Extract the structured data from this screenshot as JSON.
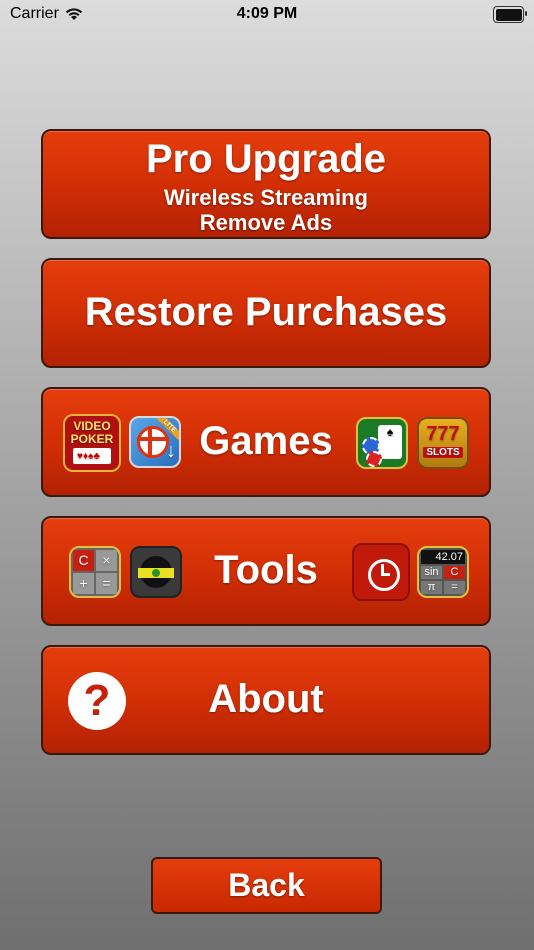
{
  "status_bar": {
    "carrier": "Carrier",
    "time": "4:09 PM",
    "icons": [
      "wifi-icon",
      "battery-icon"
    ]
  },
  "menu": {
    "pro_upgrade": {
      "title": "Pro Upgrade",
      "line1": "Wireless Streaming",
      "line2": "Remove Ads"
    },
    "restore_label": "Restore Purchases",
    "games": {
      "label": "Games",
      "icons": {
        "video_poker": {
          "line1": "VIDEO",
          "line2": "POKER"
        },
        "level_lite": {
          "badge": "LITE"
        },
        "solitaire": {},
        "slots": {
          "top": "777",
          "bottom": "SLOTS"
        }
      }
    },
    "tools": {
      "label": "Tools",
      "icons": {
        "calculator": {
          "keys": [
            "C",
            "×",
            "+",
            "="
          ]
        },
        "level": {},
        "alarm_clock": {},
        "sci_calculator": {
          "display": "42.07",
          "keys": [
            "sin",
            "C",
            "π",
            "="
          ]
        }
      }
    },
    "about_label": "About",
    "about_icon_glyph": "?"
  },
  "back_label": "Back",
  "colors": {
    "button_red": "#d22f06",
    "button_border": "#3a1a0e",
    "text": "#ffffff"
  }
}
